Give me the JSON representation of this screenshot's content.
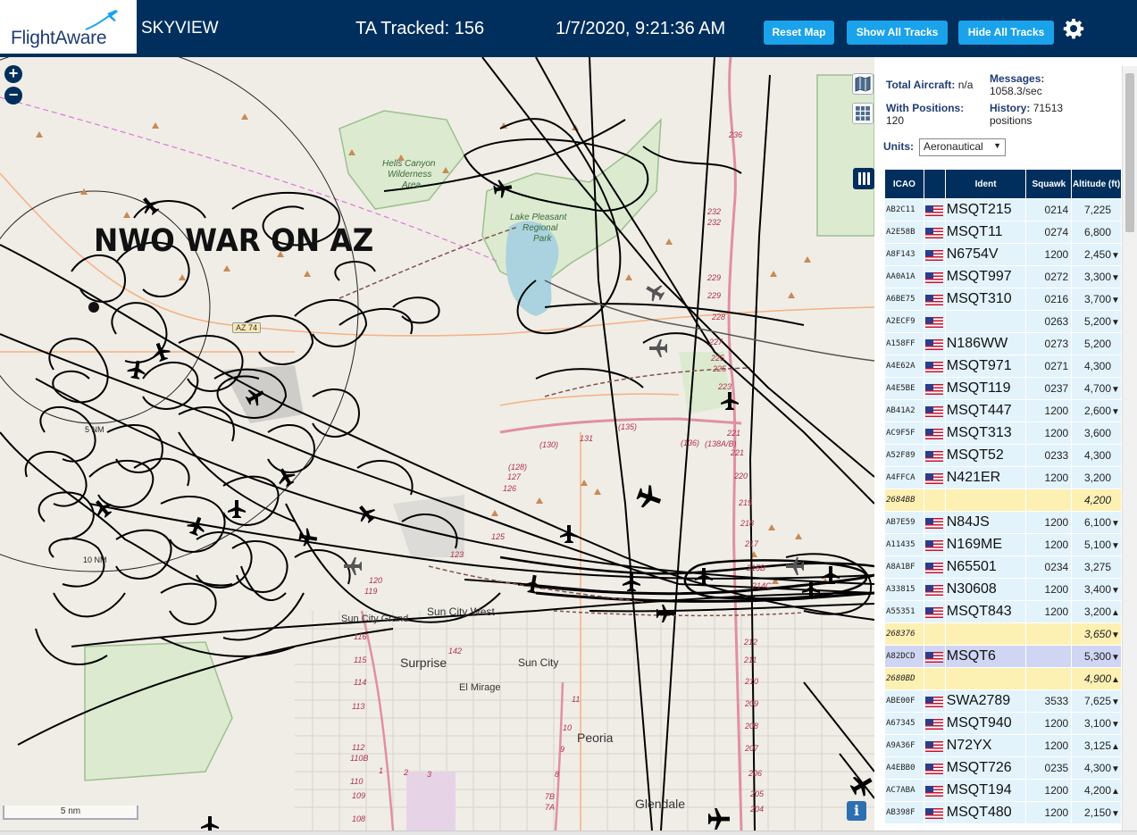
{
  "header": {
    "logo_text": "FlightAware",
    "app_title": "SKYVIEW",
    "ta_tracked": "TA Tracked: 156",
    "clock": "1/7/2020, 9:21:36 AM",
    "buttons": {
      "reset": "Reset Map",
      "show_all": "Show All Tracks",
      "hide_all": "Hide All Tracks"
    },
    "settings_icon": "gear-icon",
    "colors": {
      "bar": "#002f5d",
      "button": "#1aa2ea"
    }
  },
  "map": {
    "banner": "NWO WAR ON AZ",
    "zoom_in": "+",
    "zoom_out": "−",
    "scale_bar": "5 nm",
    "info_button": "i",
    "range_rings": [
      "5 NM",
      "10 NM"
    ],
    "place_labels": {
      "sun_city_grand": "Sun City Grand",
      "sun_city_west": "Sun City West",
      "surprise": "Surprise",
      "sun_city": "Sun City",
      "el_mirage": "El Mirage",
      "peoria": "Peoria",
      "glendale": "Glendale"
    },
    "park_labels": {
      "hells_canyon_1": "Hells Canyon",
      "hells_canyon_2": "Wilderness",
      "hells_canyon_3": "Area",
      "lake_pleasant_1": "Lake Pleasant",
      "lake_pleasant_2": "Regional",
      "lake_pleasant_3": "Park"
    },
    "shield": "AZ 74",
    "interchange_numbers": [
      "236",
      "232",
      "232",
      "229",
      "229",
      "228",
      "227",
      "225",
      "225",
      "223",
      "221",
      "221",
      "220",
      "219",
      "218",
      "217",
      "215B",
      "214C",
      "212",
      "211",
      "210",
      "209",
      "208",
      "207",
      "206",
      "205",
      "204",
      "131",
      "(130)",
      "(128)",
      "127",
      "126",
      "125",
      "123",
      "(135)",
      "(136)",
      "(138A/B)",
      "142",
      "120",
      "119",
      "116",
      "115",
      "114",
      "113",
      "112",
      "110B",
      "110",
      "109",
      "108",
      "11",
      "10",
      "9",
      "8",
      "7B",
      "7A",
      "1",
      "2",
      "3"
    ],
    "icons": [
      "plus-icon",
      "minus-icon",
      "map-layers-icon",
      "grid-icon",
      "columns-icon",
      "info-icon",
      "airplane-icon"
    ]
  },
  "sidebar": {
    "stats": {
      "total_aircraft_label": "Total Aircraft:",
      "total_aircraft_value": "n/a",
      "with_positions_label": "With Positions:",
      "with_positions_value": "120",
      "messages_label": "Messages:",
      "messages_value": "1058.3/sec",
      "history_label": "History:",
      "history_value": "71513 positions"
    },
    "units_label": "Units:",
    "units_value": "Aeronautical",
    "table": {
      "headers": [
        "ICAO",
        "",
        "Ident",
        "Squawk",
        "Altitude (ft)"
      ],
      "rows": [
        {
          "icao": "AB2C11",
          "flag": true,
          "ident": "MSQT215",
          "squawk": "0214",
          "alt": "7,225",
          "trend": "",
          "style": "normal"
        },
        {
          "icao": "A2E58B",
          "flag": true,
          "ident": "MSQT11",
          "squawk": "0274",
          "alt": "6,800",
          "trend": "",
          "style": "normal"
        },
        {
          "icao": "A8F143",
          "flag": true,
          "ident": "N6754V",
          "squawk": "1200",
          "alt": "2,450",
          "trend": "▼",
          "style": "normal"
        },
        {
          "icao": "AA0A1A",
          "flag": true,
          "ident": "MSQT997",
          "squawk": "0272",
          "alt": "3,300",
          "trend": "▼",
          "style": "normal"
        },
        {
          "icao": "A6BE75",
          "flag": true,
          "ident": "MSQT310",
          "squawk": "0216",
          "alt": "3,700",
          "trend": "▼",
          "style": "normal"
        },
        {
          "icao": "A2ECF9",
          "flag": true,
          "ident": "",
          "squawk": "0263",
          "alt": "5,200",
          "trend": "▼",
          "style": "normal"
        },
        {
          "icao": "A158FF",
          "flag": true,
          "ident": "N186WW",
          "squawk": "0273",
          "alt": "5,200",
          "trend": "",
          "style": "normal"
        },
        {
          "icao": "A4E62A",
          "flag": true,
          "ident": "MSQT971",
          "squawk": "0271",
          "alt": "4,300",
          "trend": "",
          "style": "normal"
        },
        {
          "icao": "A4E5BE",
          "flag": true,
          "ident": "MSQT119",
          "squawk": "0237",
          "alt": "4,700",
          "trend": "▼",
          "style": "normal"
        },
        {
          "icao": "AB41A2",
          "flag": true,
          "ident": "MSQT447",
          "squawk": "1200",
          "alt": "2,600",
          "trend": "▼",
          "style": "normal"
        },
        {
          "icao": "AC9F5F",
          "flag": true,
          "ident": "MSQT313",
          "squawk": "1200",
          "alt": "3,600",
          "trend": "",
          "style": "normal"
        },
        {
          "icao": "A52F89",
          "flag": true,
          "ident": "MSQT52",
          "squawk": "0233",
          "alt": "4,300",
          "trend": "",
          "style": "normal"
        },
        {
          "icao": "A4FFCA",
          "flag": true,
          "ident": "N421ER",
          "squawk": "1200",
          "alt": "3,200",
          "trend": "",
          "style": "normal"
        },
        {
          "icao": "2684BB",
          "flag": false,
          "ident": "",
          "squawk": "",
          "alt": "4,200",
          "trend": "",
          "style": "noflag"
        },
        {
          "icao": "AB7E59",
          "flag": true,
          "ident": "N84JS",
          "squawk": "1200",
          "alt": "6,100",
          "trend": "▼",
          "style": "normal"
        },
        {
          "icao": "A11435",
          "flag": true,
          "ident": "N169ME",
          "squawk": "1200",
          "alt": "5,100",
          "trend": "▼",
          "style": "normal"
        },
        {
          "icao": "A8A1BF",
          "flag": true,
          "ident": "N65501",
          "squawk": "0234",
          "alt": "3,275",
          "trend": "",
          "style": "normal"
        },
        {
          "icao": "A33815",
          "flag": true,
          "ident": "N30608",
          "squawk": "1200",
          "alt": "3,400",
          "trend": "▼",
          "style": "normal"
        },
        {
          "icao": "A55351",
          "flag": true,
          "ident": "MSQT843",
          "squawk": "1200",
          "alt": "3,200",
          "trend": "▲",
          "style": "normal"
        },
        {
          "icao": "268376",
          "flag": false,
          "ident": "",
          "squawk": "",
          "alt": "3,650",
          "trend": "▼",
          "style": "noflag"
        },
        {
          "icao": "A82DCD",
          "flag": true,
          "ident": "MSQT6",
          "squawk": "",
          "alt": "5,300",
          "trend": "▼",
          "style": "selected"
        },
        {
          "icao": "2680BD",
          "flag": false,
          "ident": "",
          "squawk": "",
          "alt": "4,900",
          "trend": "▲",
          "style": "noflag"
        },
        {
          "icao": "ABE00F",
          "flag": true,
          "ident": "SWA2789",
          "squawk": "3533",
          "alt": "7,625",
          "trend": "▼",
          "style": "normal"
        },
        {
          "icao": "A67345",
          "flag": true,
          "ident": "MSQT940",
          "squawk": "1200",
          "alt": "3,100",
          "trend": "▼",
          "style": "normal"
        },
        {
          "icao": "A9A36F",
          "flag": true,
          "ident": "N72YX",
          "squawk": "1200",
          "alt": "3,125",
          "trend": "▲",
          "style": "normal"
        },
        {
          "icao": "A4EBB0",
          "flag": true,
          "ident": "MSQT726",
          "squawk": "0235",
          "alt": "4,300",
          "trend": "▼",
          "style": "normal"
        },
        {
          "icao": "AC7ABA",
          "flag": true,
          "ident": "MSQT194",
          "squawk": "1200",
          "alt": "4,200",
          "trend": "▲",
          "style": "normal"
        },
        {
          "icao": "AB398F",
          "flag": true,
          "ident": "MSQT480",
          "squawk": "1200",
          "alt": "2,150",
          "trend": "▼",
          "style": "normal"
        }
      ]
    }
  }
}
